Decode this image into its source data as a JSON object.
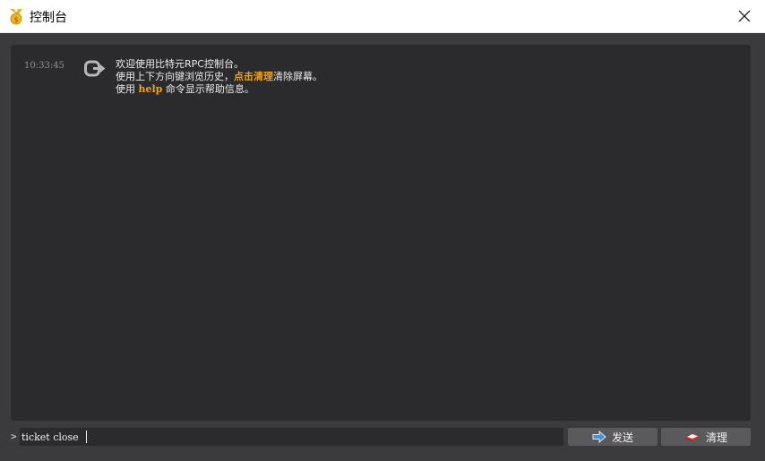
{
  "window": {
    "title": "控制台",
    "close_label": "Close"
  },
  "console": {
    "timestamp": "10:33:45",
    "welcome": {
      "line1": "欢迎使用比特元RPC控制台。",
      "line2_before": "使用上下方向键浏览历史，",
      "line2_highlight": "点击清理",
      "line2_after": "清除屏幕。",
      "line3_before": "使用 ",
      "line3_highlight": "help",
      "line3_after": " 命令显示帮助信息。"
    }
  },
  "input": {
    "prompt": ">",
    "value": "ticket close"
  },
  "buttons": {
    "send_label": "发送",
    "clear_label": "清理"
  },
  "colors": {
    "highlight": "#f0a21b",
    "console_bg": "#2b2b2d",
    "window_bg": "#3b3b3d",
    "button_bg": "#5a5a5d",
    "send_icon": "#4a90d9",
    "clear_icon": "#d32f2f"
  },
  "icons": {
    "app": "coin-icon",
    "message": "console-arrow-icon",
    "send": "arrow-right-icon",
    "clear": "eraser-icon"
  }
}
